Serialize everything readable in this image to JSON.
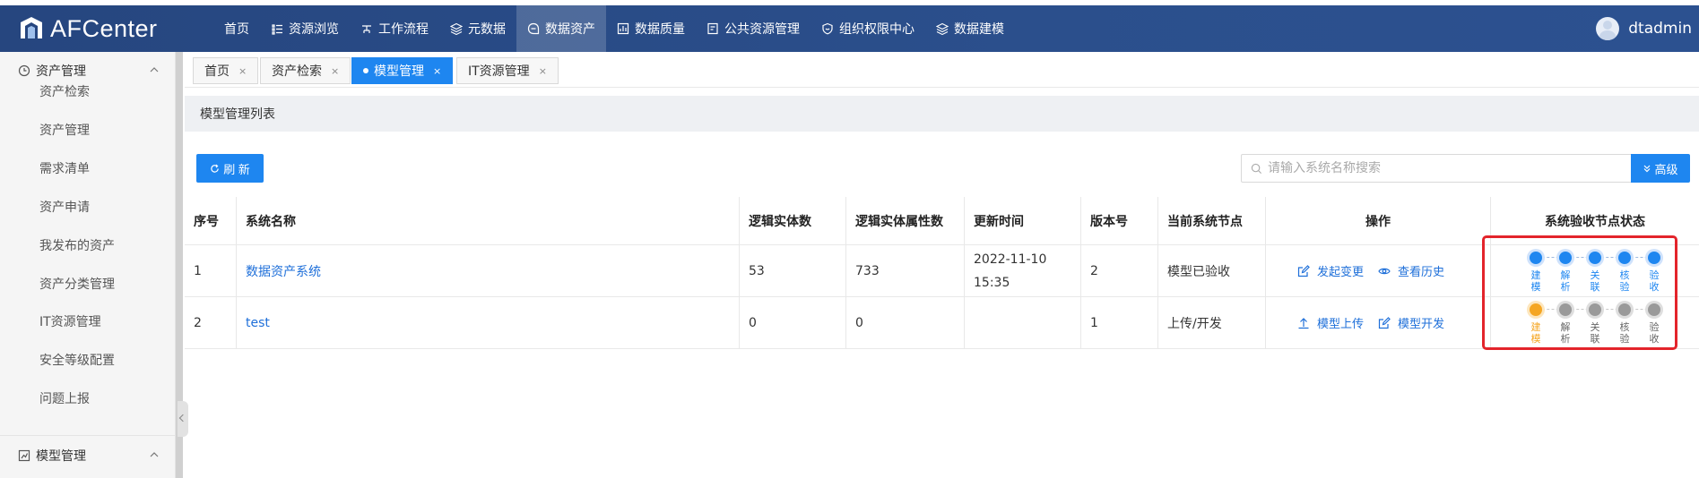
{
  "app": {
    "title": "AFCenter",
    "user": "dtadmin"
  },
  "nav": [
    {
      "label": "首页",
      "icon": "none",
      "active": false
    },
    {
      "label": "资源浏览",
      "icon": "list-icon",
      "active": false
    },
    {
      "label": "工作流程",
      "icon": "workflow-icon",
      "active": false
    },
    {
      "label": "元数据",
      "icon": "layers-icon",
      "active": false
    },
    {
      "label": "数据资产",
      "icon": "asset-icon",
      "active": true
    },
    {
      "label": "数据质量",
      "icon": "chart-icon",
      "active": false
    },
    {
      "label": "公共资源管理",
      "icon": "folder-icon",
      "active": false
    },
    {
      "label": "组织权限中心",
      "icon": "shield-icon",
      "active": false
    },
    {
      "label": "数据建模",
      "icon": "layers-icon",
      "active": false
    }
  ],
  "sidebar": {
    "group1": "资产管理",
    "items": [
      "资产检索",
      "资产管理",
      "需求清单",
      "资产申请",
      "我发布的资产",
      "资产分类管理",
      "IT资源管理",
      "安全等级配置",
      "问题上报"
    ],
    "group2": "模型管理"
  },
  "tabs": [
    {
      "label": "首页",
      "active": false
    },
    {
      "label": "资产检索",
      "active": false
    },
    {
      "label": "模型管理",
      "active": true
    },
    {
      "label": "IT资源管理",
      "active": false
    }
  ],
  "tab_close": "×",
  "panel": {
    "title": "模型管理列表"
  },
  "toolbar": {
    "refresh_label": "刷 新",
    "search_placeholder": "请输入系统名称搜索",
    "advanced_label": "高级"
  },
  "table": {
    "headers": [
      "序号",
      "系统名称",
      "逻辑实体数",
      "逻辑实体属性数",
      "更新时间",
      "版本号",
      "当前系统节点",
      "操作",
      "系统验收节点状态"
    ],
    "rows": [
      {
        "index": "1",
        "name": "数据资产系统",
        "entities": "53",
        "attributes": "733",
        "updated": "2022-11-10 15:35",
        "version": "2",
        "node": "模型已验收",
        "ops": [
          {
            "label": "发起变更",
            "icon": "edit-icon"
          },
          {
            "label": "查看历史",
            "icon": "eye-icon"
          }
        ],
        "steps": [
          {
            "label": "建模",
            "state": "done"
          },
          {
            "label": "解析",
            "state": "done"
          },
          {
            "label": "关联",
            "state": "done"
          },
          {
            "label": "核验",
            "state": "done"
          },
          {
            "label": "验收",
            "state": "done"
          }
        ]
      },
      {
        "index": "2",
        "name": "test",
        "entities": "0",
        "attributes": "0",
        "updated": "",
        "version": "1",
        "node": "上传/开发",
        "ops": [
          {
            "label": "模型上传",
            "icon": "upload-icon"
          },
          {
            "label": "模型开发",
            "icon": "edit-icon"
          }
        ],
        "steps": [
          {
            "label": "建模",
            "state": "current"
          },
          {
            "label": "解析",
            "state": "pending"
          },
          {
            "label": "关联",
            "state": "pending"
          },
          {
            "label": "核验",
            "state": "pending"
          },
          {
            "label": "验收",
            "state": "pending"
          }
        ]
      }
    ]
  },
  "colors": {
    "primary": "#1e86f0",
    "topbar": "#2b4f8c",
    "pending": "#9a9a9a",
    "current": "#f5a623",
    "highlight": "#e3242b"
  }
}
